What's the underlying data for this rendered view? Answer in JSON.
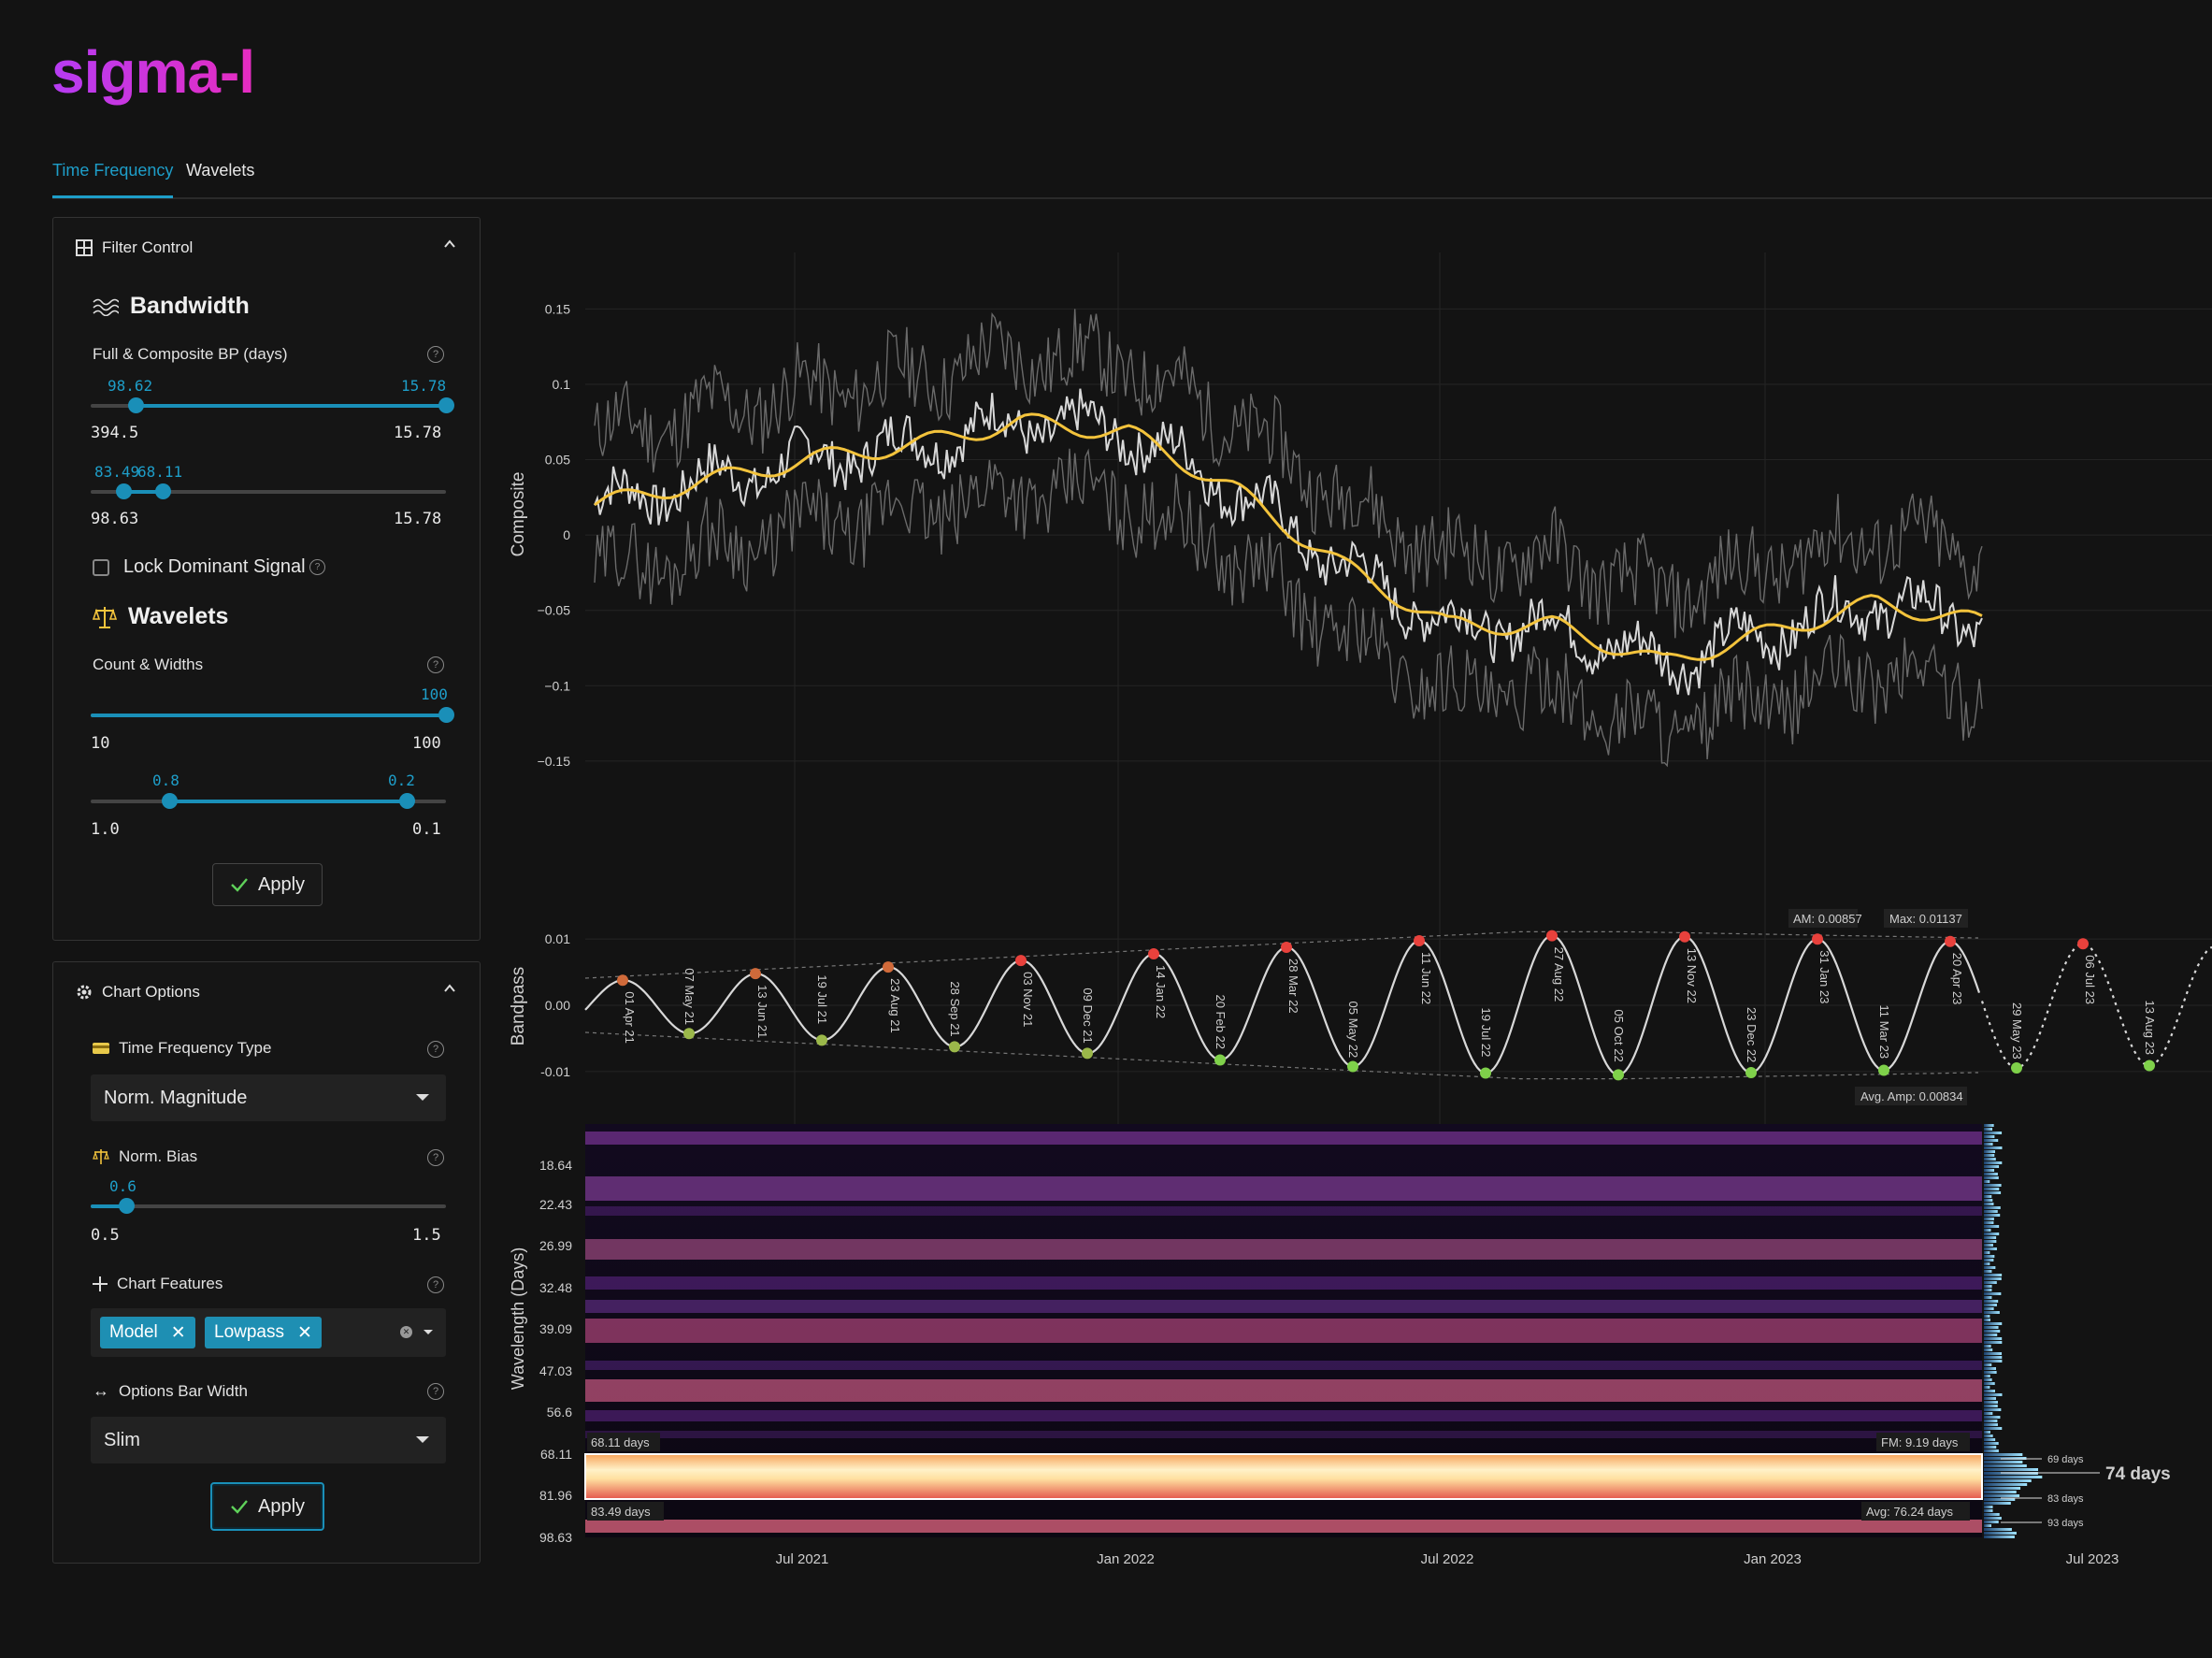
{
  "app": {
    "logo": "sigma-l"
  },
  "tabs": [
    {
      "label": "Time Frequency"
    },
    {
      "label": "Wavelets"
    }
  ],
  "filter_control": {
    "title": "Filter Control",
    "bandwidth": {
      "title": "Bandwidth",
      "label": "Full & Composite BP (days)",
      "slider1": {
        "left_value": "98.62",
        "right_value": "15.78",
        "min": "394.5",
        "max": "15.78"
      },
      "slider2": {
        "left_value": "83.49",
        "right_value": "68.11",
        "min": "98.63",
        "max": "15.78"
      },
      "lock_label": "Lock Dominant Signal"
    },
    "wavelets": {
      "title": "Wavelets",
      "label": "Count & Widths",
      "slider1": {
        "value": "100",
        "min": "10",
        "max": "100"
      },
      "slider2": {
        "left_value": "0.8",
        "right_value": "0.2",
        "min": "1.0",
        "max": "0.1"
      }
    },
    "apply_label": "Apply"
  },
  "chart_options": {
    "title": "Chart Options",
    "tf_type": {
      "label": "Time Frequency Type",
      "selected": "Norm. Magnitude"
    },
    "norm_bias": {
      "label": "Norm. Bias",
      "value": "0.6",
      "min": "0.5",
      "max": "1.5"
    },
    "chart_features": {
      "label": "Chart Features",
      "chips": [
        {
          "label": "Model"
        },
        {
          "label": "Lowpass"
        }
      ]
    },
    "options_bar_width": {
      "label": "Options Bar Width",
      "selected": "Slim"
    },
    "apply_label": "Apply"
  },
  "colors": {
    "accent": "#1e9ec9",
    "composite": "#f3c33c",
    "peak": "#e8413c",
    "trough": "#7fd14a",
    "logo_start": "#b63cf3",
    "logo_end": "#e62cc0"
  },
  "chart_data": [
    {
      "type": "line",
      "ylabel": "Composite",
      "ylim": [
        -0.16,
        0.18
      ],
      "yticks": [
        "0.15",
        "0.1",
        "0.05",
        "0",
        "−0.05",
        "−0.1",
        "−0.15"
      ],
      "series": [],
      "x_dates": [
        "2021-03",
        "2021-05",
        "2021-07",
        "2021-09",
        "2021-11",
        "2022-01",
        "2022-03",
        "2022-05",
        "2022-07",
        "2022-09",
        "2022-11",
        "2023-01",
        "2023-03",
        "2023-05"
      ],
      "lowpass": [
        0.02,
        0.035,
        0.05,
        0.06,
        0.075,
        0.068,
        0.03,
        -0.02,
        -0.06,
        -0.06,
        -0.085,
        -0.065,
        -0.045,
        -0.058
      ]
    },
    {
      "type": "line",
      "ylabel": "Bandpass",
      "ylim": [
        -0.012,
        0.012
      ],
      "yticks": [
        "0.01",
        "0.00",
        "-0.01"
      ],
      "annotations": {
        "am": "AM: 0.00857",
        "max": "Max: 0.01137",
        "avg_amp": "Avg. Amp: 0.00834"
      },
      "peaks": [
        "01 Apr 21",
        "13 Jun 21",
        "23 Aug 21",
        "03 Nov 21",
        "14 Jan 22",
        "28 Mar 22",
        "11 Jun 22",
        "27 Aug 22",
        "13 Nov 22",
        "31 Jan 23",
        "20 Apr 23",
        "06 Jul 23"
      ],
      "troughs": [
        "07 May 21",
        "19 Jul 21",
        "28 Sep 21",
        "09 Dec 21",
        "20 Feb 22",
        "05 May 22",
        "19 Jul 22",
        "05 Oct 22",
        "23 Dec 22",
        "11 Mar 23",
        "29 May 23",
        "13 Aug 23"
      ]
    },
    {
      "type": "heatmap",
      "ylabel": "Wavelength (Days)",
      "yticks": [
        "18.64",
        "22.43",
        "26.99",
        "32.48",
        "39.09",
        "47.03",
        "56.6",
        "68.11",
        "81.96",
        "98.63"
      ],
      "xticks": [
        "Jul 2021",
        "Jan 2022",
        "Jul 2022",
        "Jan 2023",
        "Jul 2023"
      ],
      "band_top_label": "68.11 days",
      "band_bottom_label": "83.49 days",
      "fm_label": "FM: 9.19 days",
      "avg_label": "Avg: 76.24 days",
      "side_peaks": [
        {
          "label": "69 days"
        },
        {
          "label": "74 days"
        },
        {
          "label": "83 days"
        },
        {
          "label": "93 days"
        }
      ]
    }
  ]
}
